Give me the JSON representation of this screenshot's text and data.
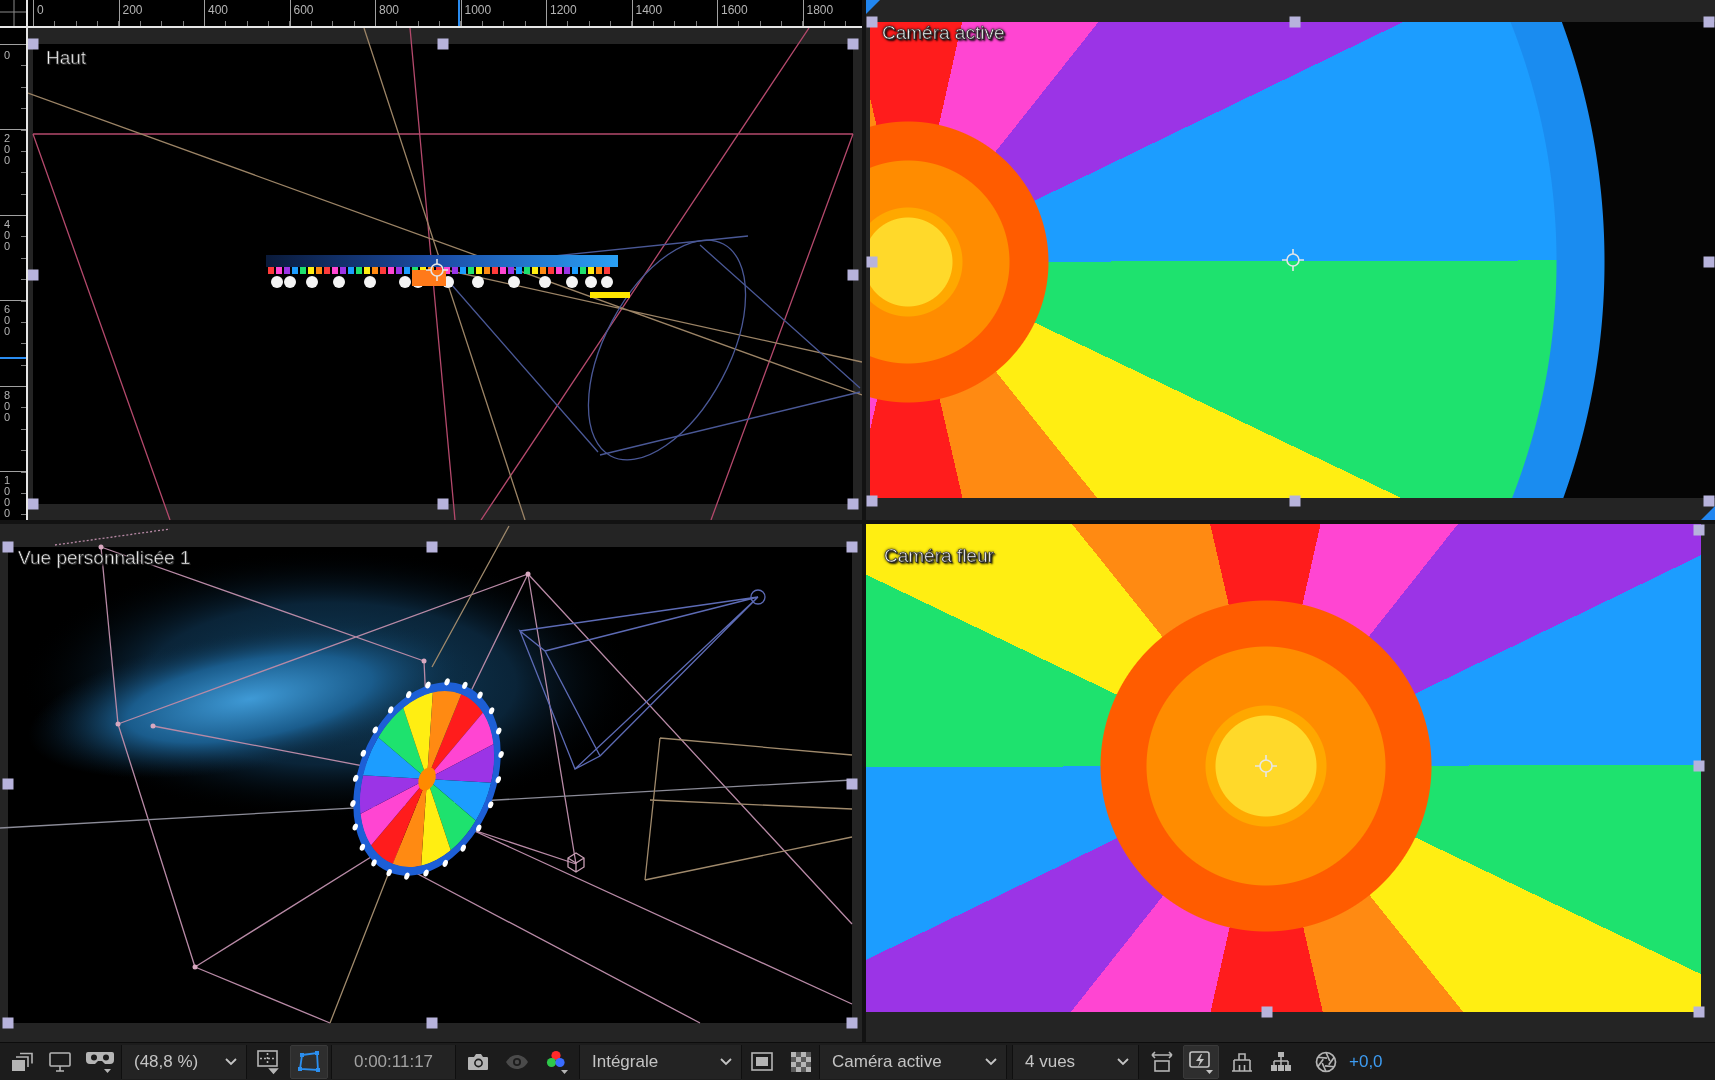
{
  "views": [
    {
      "kind": "top",
      "label": "Haut",
      "selected": false,
      "rulers": {
        "horizontal": [
          "0",
          "200",
          "400",
          "600",
          "800",
          "1000",
          "1200",
          "1400",
          "1600",
          "1800"
        ],
        "vertical": [
          "0",
          "200",
          "400",
          "600",
          "800",
          "1000"
        ]
      }
    },
    {
      "kind": "render",
      "label": "Caméra active",
      "selected": true
    },
    {
      "kind": "perspective",
      "label": "Vue personnalisée 1",
      "selected": false
    },
    {
      "kind": "closeup",
      "label": "Caméra fleur",
      "selected": false
    }
  ],
  "toolbar": {
    "zoom": "(48,8 %)",
    "mask_path": {
      "on": true
    },
    "timecode": "0:00:11:17",
    "show_snapshot": {
      "disabled": true
    },
    "resolution": "Intégrale",
    "camera_view": "Caméra active",
    "layout": "4 vues",
    "fast_previews": {
      "on": true
    },
    "exposure": "+0,0"
  }
}
